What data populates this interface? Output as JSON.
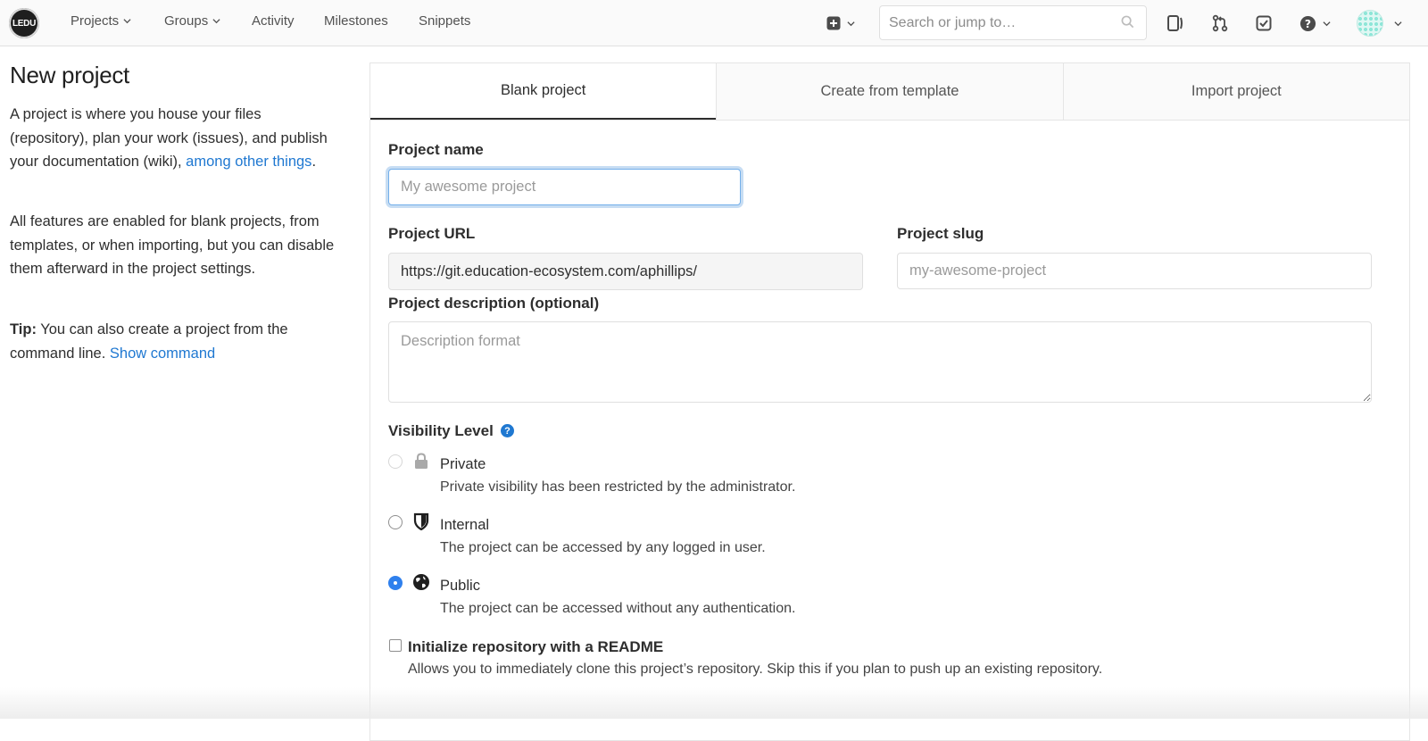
{
  "navbar": {
    "logo_text": "LEDU",
    "items": [
      {
        "label": "Projects",
        "dropdown": true
      },
      {
        "label": "Groups",
        "dropdown": true
      },
      {
        "label": "Activity",
        "dropdown": false
      },
      {
        "label": "Milestones",
        "dropdown": false
      },
      {
        "label": "Snippets",
        "dropdown": false
      }
    ],
    "search_placeholder": "Search or jump to…",
    "icons": [
      "plus-square-icon",
      "search-icon",
      "sidebar-toggle-icon",
      "merge-request-icon",
      "todo-check-icon",
      "help-icon",
      "user-avatar"
    ]
  },
  "left": {
    "title": "New project",
    "intro_text": "A project is where you house your files (repository), plan your work (issues), and publish your documentation (wiki), ",
    "intro_link": "among other things",
    "intro_end": ".",
    "features_text": "All features are enabled for blank projects, from templates, or when importing, but you can disable them afterward in the project settings.",
    "tip_label": "Tip:",
    "tip_text": " You can also create a project from the command line. ",
    "tip_link": "Show command"
  },
  "tabs": [
    "Blank project",
    "Create from template",
    "Import project"
  ],
  "active_tab": "Blank project",
  "form": {
    "name_label": "Project name",
    "name_placeholder": "My awesome project",
    "url_label": "Project URL",
    "url_value": "https://git.education-ecosystem.com/aphillips/",
    "slug_label": "Project slug",
    "slug_placeholder": "my-awesome-project",
    "desc_label": "Project description (optional)",
    "desc_placeholder": "Description format",
    "visibility_label": "Visibility Level",
    "visibility_help": "?",
    "visibility": [
      {
        "title": "Private",
        "desc": "Private visibility has been restricted by the administrator.",
        "state": "disabled",
        "icon": "lock-icon"
      },
      {
        "title": "Internal",
        "desc": "The project can be accessed by any logged in user.",
        "state": "unchecked",
        "icon": "shield-icon"
      },
      {
        "title": "Public",
        "desc": "The project can be accessed without any authentication.",
        "state": "checked",
        "icon": "globe-icon"
      }
    ],
    "readme_label": "Initialize repository with a README",
    "readme_desc": "Allows you to immediately clone this project’s repository. Skip this if you plan to push up an existing repository.",
    "readme_checked": false
  },
  "colors": {
    "link": "#1f78d1",
    "radio_checked": "#2f80ed",
    "focus_border": "#73afea"
  }
}
